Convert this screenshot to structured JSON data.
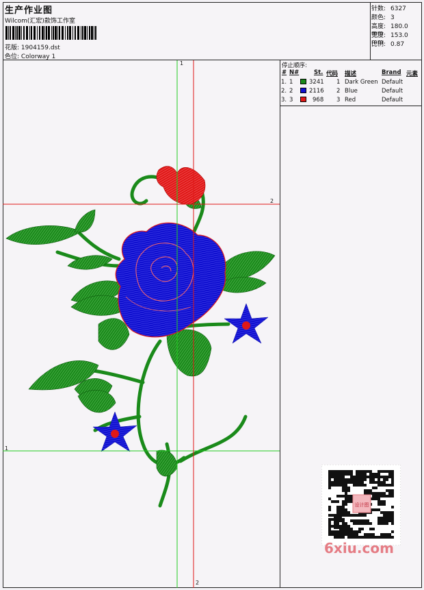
{
  "header": {
    "title": "生产作业图",
    "company": "Wilcom(汇宏)款饰工作室",
    "design_label": "花版:",
    "design_file": "1904159.dst",
    "colorway_label": "色位:",
    "colorway": "Colorway 1"
  },
  "stats": [
    {
      "label": "针数:",
      "value": "6327"
    },
    {
      "label": "颜色:",
      "value": "3"
    },
    {
      "label": "高度:",
      "value": "180.0 mm"
    },
    {
      "label": "宽度:",
      "value": "153.0 mm"
    },
    {
      "label": "比例:",
      "value": "0.87"
    }
  ],
  "stop_sequence": {
    "title": "停止顺序:",
    "headers": {
      "num": "#",
      "no": "N#",
      "stitches": "St.",
      "code": "代码",
      "desc": "描述",
      "brand": "Brand",
      "element": "元素"
    },
    "rows": [
      {
        "num": "1.",
        "no": "1",
        "color": "#1a8a1a",
        "stitches": "3241",
        "code": "1",
        "desc": "Dark Green",
        "brand": "Default"
      },
      {
        "num": "2.",
        "no": "2",
        "color": "#1010d0",
        "stitches": "2116",
        "code": "2",
        "desc": "Blue",
        "brand": "Default"
      },
      {
        "num": "3.",
        "no": "3",
        "color": "#e01818",
        "stitches": "968",
        "code": "3",
        "desc": "Red",
        "brand": "Default"
      }
    ]
  },
  "guides": {
    "v_green": "1",
    "h_green": "1",
    "h_red": "2",
    "v_red": "2"
  },
  "watermark": "6xiu.com",
  "qr_text": "设计图",
  "colors": {
    "green": "#1a8a1a",
    "blue": "#1010d0",
    "red": "#e01818",
    "guide_green": "#22cc22",
    "guide_red": "#e01818"
  }
}
